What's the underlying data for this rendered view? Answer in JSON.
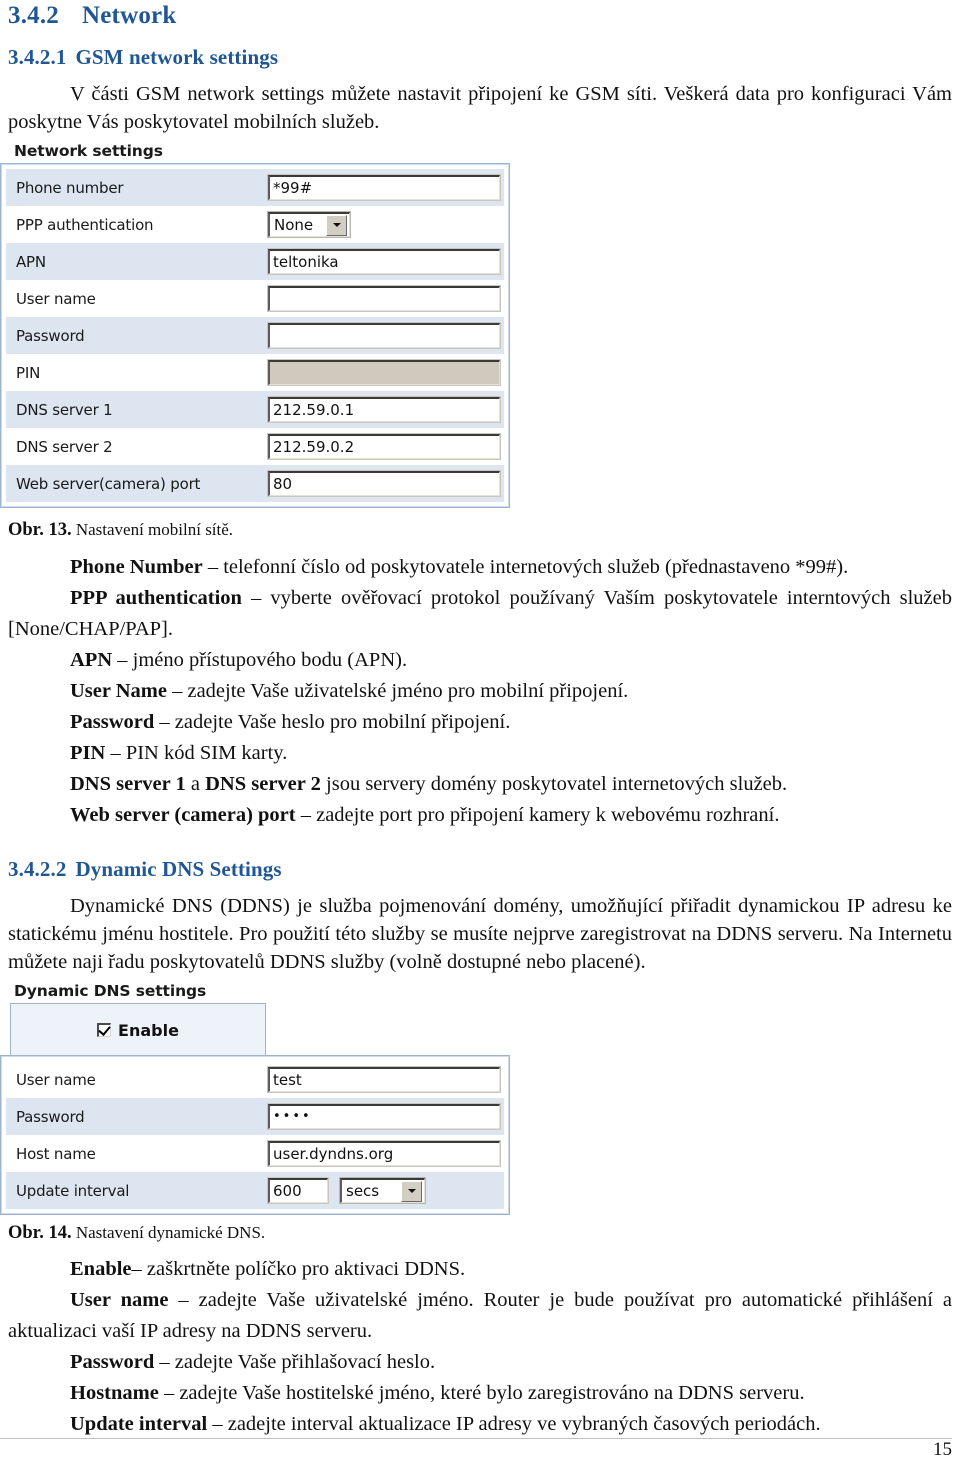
{
  "document": {
    "page_number": "15",
    "heading_color": "#1F5693"
  },
  "section": {
    "number": "3.4.2",
    "title": "Network"
  },
  "subsection_gsm": {
    "number": "3.4.2.1",
    "title": "GSM network settings",
    "intro": "V části GSM network settings můžete nastavit připojení ke GSM síti. Veškerá data pro konfiguraci Vám poskytne Vás poskytovatel mobilních služeb."
  },
  "network_form": {
    "title": "Network settings",
    "rows": [
      {
        "label": "Phone number",
        "control": "text",
        "value": "*99#",
        "shaded": true
      },
      {
        "label": "PPP authentication",
        "control": "select",
        "value": "None",
        "shaded": false
      },
      {
        "label": "APN",
        "control": "text",
        "value": "teltonika",
        "shaded": true
      },
      {
        "label": "User name",
        "control": "text",
        "value": "",
        "shaded": false
      },
      {
        "label": "Password",
        "control": "text",
        "value": "",
        "shaded": true
      },
      {
        "label": "PIN",
        "control": "disabled",
        "value": "",
        "shaded": false
      },
      {
        "label": "DNS server 1",
        "control": "text",
        "value": "212.59.0.1",
        "shaded": true
      },
      {
        "label": "DNS server 2",
        "control": "text",
        "value": "212.59.0.2",
        "shaded": false
      },
      {
        "label": "Web server(camera) port",
        "control": "text",
        "value": "80",
        "shaded": true
      }
    ]
  },
  "caption_13": {
    "label": "Obr. 13.",
    "text": "Nastavení mobilní sítě."
  },
  "gsm_definitions": [
    {
      "term": "Phone Number",
      "rest": " – telefonní číslo od poskytovatele internetových služeb (přednastaveno *99#)."
    },
    {
      "term": "PPP authentication",
      "rest": " – vyberte ověřovací protokol používaný Vaším poskytovatele interntových služeb [None/CHAP/PAP]."
    },
    {
      "term": "APN",
      "rest": " – jméno přístupového bodu (APN)."
    },
    {
      "term": "User Name",
      "rest": " – zadejte Vaše uživatelské jméno pro mobilní připojení."
    },
    {
      "term": "Password",
      "rest": " – zadejte Vaše heslo pro mobilní připojení."
    },
    {
      "term": "PIN",
      "rest": " – PIN kód SIM karty."
    },
    {
      "term": "DNS server 1",
      "term2": "DNS server 2",
      "mid": " a ",
      "rest": " jsou servery domény poskytovatel internetových služeb."
    },
    {
      "term": "Web server (camera) port",
      "rest": " – zadejte port pro připojení kamery k webovému rozhraní."
    }
  ],
  "subsection_ddns": {
    "number": "3.4.2.2",
    "title": "Dynamic DNS Settings",
    "intro": "Dynamické DNS (DDNS) je služba pojmenování domény, umožňující přiřadit dynamickou IP adresu ke statickému jménu hostitele. Pro použití této služby se musíte nejprve zaregistrovat na DDNS serveru. Na Internetu můžete naji řadu poskytovatelů DDNS služby (volně dostupné nebo placené)."
  },
  "ddns_form": {
    "title": "Dynamic DNS settings",
    "enable": {
      "label": "Enable",
      "checked": true
    },
    "rows": [
      {
        "label": "User name",
        "control": "text",
        "value": "test",
        "shaded": false
      },
      {
        "label": "Password",
        "control": "pwd",
        "value": "••••",
        "shaded": true
      },
      {
        "label": "Host name",
        "control": "text",
        "value": "user.dyndns.org",
        "shaded": false
      },
      {
        "label": "Update interval",
        "control": "combo",
        "value": "600",
        "unit": "secs",
        "shaded": true
      }
    ]
  },
  "caption_14": {
    "label": "Obr. 14.",
    "text": "Nastavení dynamické DNS."
  },
  "ddns_definitions": [
    {
      "term": "Enable",
      "rest": "– zaškrtněte políčko pro aktivaci DDNS."
    },
    {
      "term": "User name",
      "rest": " – zadejte Vaše uživatelské jméno. Router je bude používat pro automatické přihlášení a aktualizaci vaší IP adresy na DDNS serveru."
    },
    {
      "term": "Password",
      "rest": " – zadejte Vaše přihlašovací heslo."
    },
    {
      "term": "Hostname",
      "rest": " – zadejte Vaše hostitelské jméno, které bylo zaregistrováno na DDNS serveru."
    },
    {
      "term": "Update interval",
      "rest": " – zadejte interval aktualizace IP adresy ve vybraných časových periodách."
    }
  ]
}
